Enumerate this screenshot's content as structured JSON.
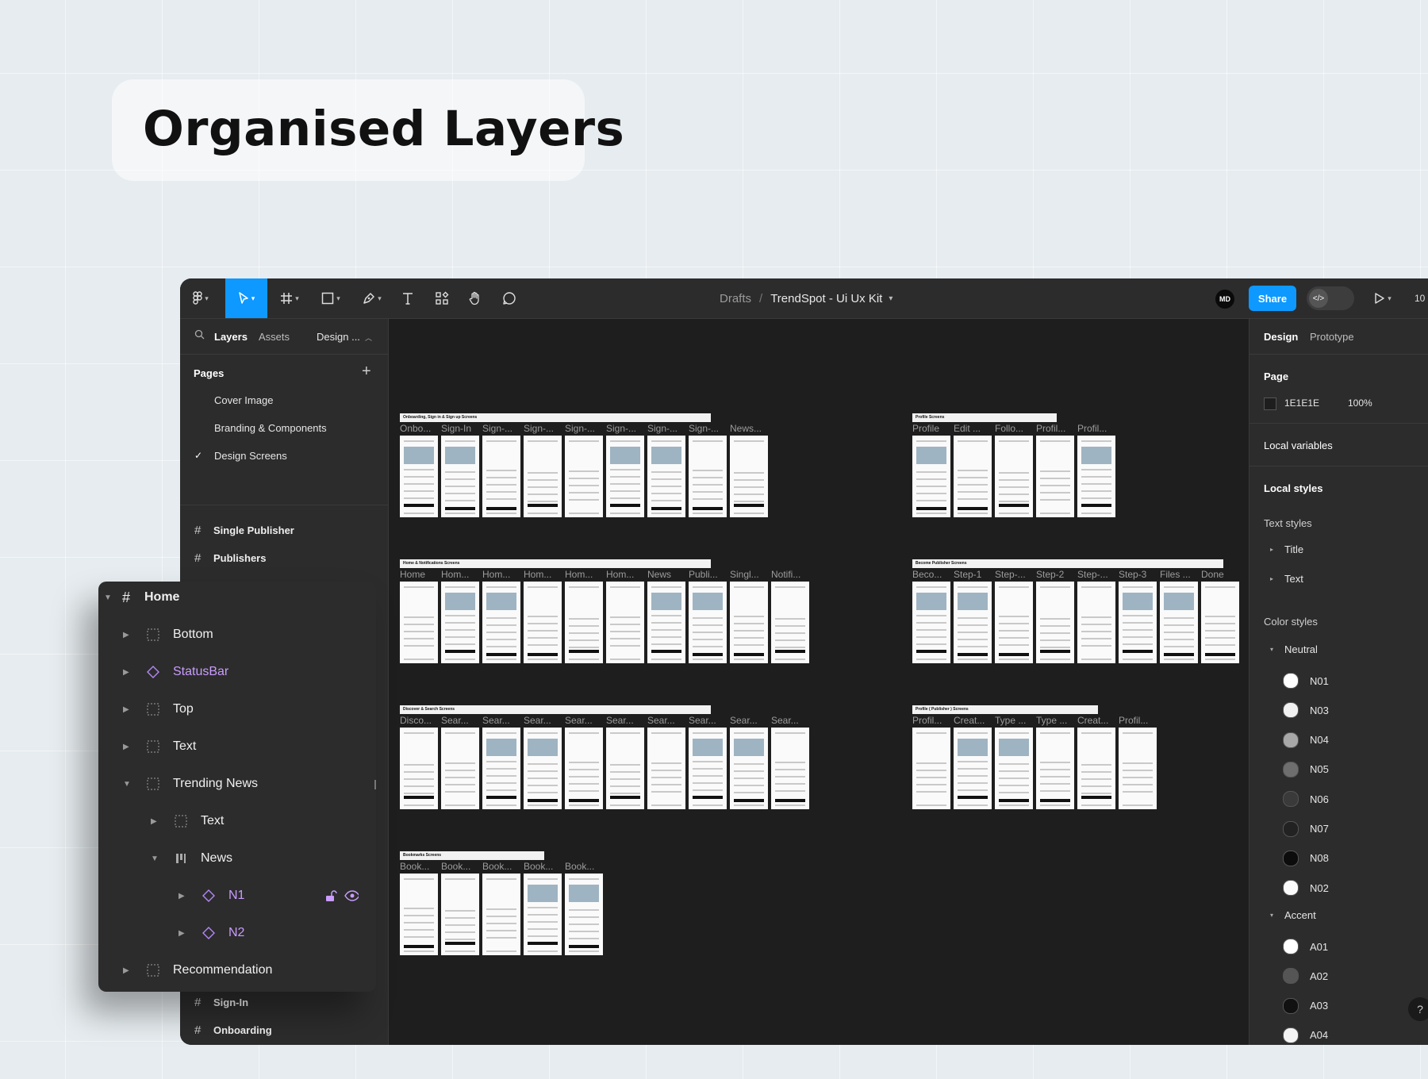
{
  "hero": {
    "title": "Organised Layers"
  },
  "toolbar": {
    "breadcrumb_root": "Drafts",
    "breadcrumb_sep": "/",
    "file_name": "TrendSpot - Ui Ux Kit",
    "avatar_initials": "MD",
    "share_label": "Share",
    "zoom": "10",
    "accent_color": "#0d99ff"
  },
  "left_panel": {
    "tabs": {
      "layers": "Layers",
      "assets": "Assets",
      "page": "Design ..."
    },
    "pages_title": "Pages",
    "pages": [
      "Cover Image",
      "Branding & Components",
      "Design Screens"
    ],
    "frames_top": [
      "Single Publisher",
      "Publishers"
    ],
    "frames_bottom": [
      "Sign-In",
      "Onboarding"
    ]
  },
  "layers_panel": {
    "root": "Home",
    "rows": [
      "Bottom",
      "StatusBar",
      "Top",
      "Text",
      "Trending News",
      "Text",
      "News",
      "N1",
      "N2",
      "Recommendation"
    ]
  },
  "canvas": {
    "sections": [
      {
        "title": "Onboarding, Sign in & Sign up Screens",
        "frames": [
          "Onbo...",
          "Sign-In",
          "Sign-...",
          "Sign-...",
          "Sign-...",
          "Sign-...",
          "Sign-...",
          "Sign-...",
          "News..."
        ]
      },
      {
        "title": "Home & Notifications Screens",
        "frames": [
          "Home",
          "Hom...",
          "Hom...",
          "Hom...",
          "Hom...",
          "Hom...",
          "News",
          "Publi...",
          "Singl...",
          "Notifi..."
        ]
      },
      {
        "title": "Discover & Search Screens",
        "frames": [
          "Disco...",
          "Sear...",
          "Sear...",
          "Sear...",
          "Sear...",
          "Sear...",
          "Sear...",
          "Sear...",
          "Sear...",
          "Sear..."
        ]
      },
      {
        "title": "Bookmarks Screens",
        "frames": [
          "Book...",
          "Book...",
          "Book...",
          "Book...",
          "Book..."
        ]
      },
      {
        "title": "Profile Screens",
        "frames": [
          "Profile",
          "Edit ...",
          "Follo...",
          "Profil...",
          "Profil..."
        ]
      },
      {
        "title": "Become Publisher Screens",
        "frames": [
          "Beco...",
          "Step-1",
          "Step-...",
          "Step-2",
          "Step-...",
          "Step-3",
          "Files ...",
          "Done"
        ]
      },
      {
        "title": "Profile ( Publisher ) Screens",
        "frames": [
          "Profil...",
          "Creat...",
          "Type ...",
          "Type ...",
          "Creat...",
          "Profil..."
        ]
      }
    ]
  },
  "right_panel": {
    "tab_design": "Design",
    "tab_prototype": "Prototype",
    "page_title": "Page",
    "page_color_hex": "1E1E1E",
    "page_opacity": "100%",
    "local_variables": "Local variables",
    "local_styles": "Local styles",
    "text_styles_title": "Text styles",
    "text_styles": [
      "Title",
      "Text"
    ],
    "color_styles_title": "Color styles",
    "neutral_group": "Neutral",
    "neutral": [
      {
        "name": "N01",
        "color": "#ffffff"
      },
      {
        "name": "N03",
        "color": "#f1f1f1"
      },
      {
        "name": "N04",
        "color": "#a8a8a8"
      },
      {
        "name": "N05",
        "color": "#6e6e6e"
      },
      {
        "name": "N06",
        "color": "#3a3a3a"
      },
      {
        "name": "N07",
        "color": "#222222"
      },
      {
        "name": "N08",
        "color": "#0c0c0c"
      },
      {
        "name": "N02",
        "color": "#fafafa"
      }
    ],
    "accent_group": "Accent",
    "accent": [
      {
        "name": "A01",
        "color": "#ffffff"
      },
      {
        "name": "A02",
        "color": "#555555"
      },
      {
        "name": "A03",
        "color": "#111111"
      },
      {
        "name": "A04",
        "color": "#f4f4f4"
      }
    ],
    "help": "?"
  }
}
